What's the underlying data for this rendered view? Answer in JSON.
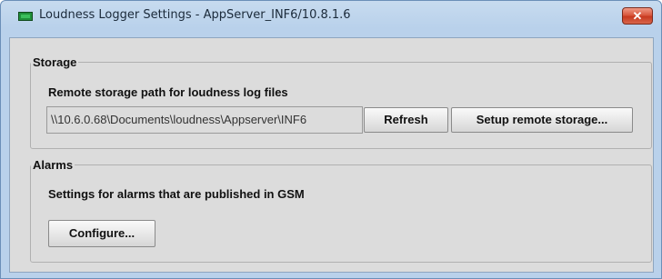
{
  "window": {
    "title": "Loudness Logger Settings - AppServer_INF6/10.8.1.6",
    "close_glyph": "✕"
  },
  "storage": {
    "group_title": "Storage",
    "description": "Remote storage path for loudness log files",
    "path_value": "\\\\10.6.0.68\\Documents\\loudness\\Appserver\\INF6",
    "refresh_label": "Refresh",
    "setup_label": "Setup remote storage..."
  },
  "alarms": {
    "group_title": "Alarms",
    "description": "Settings for alarms that are published in GSM",
    "configure_label": "Configure..."
  }
}
